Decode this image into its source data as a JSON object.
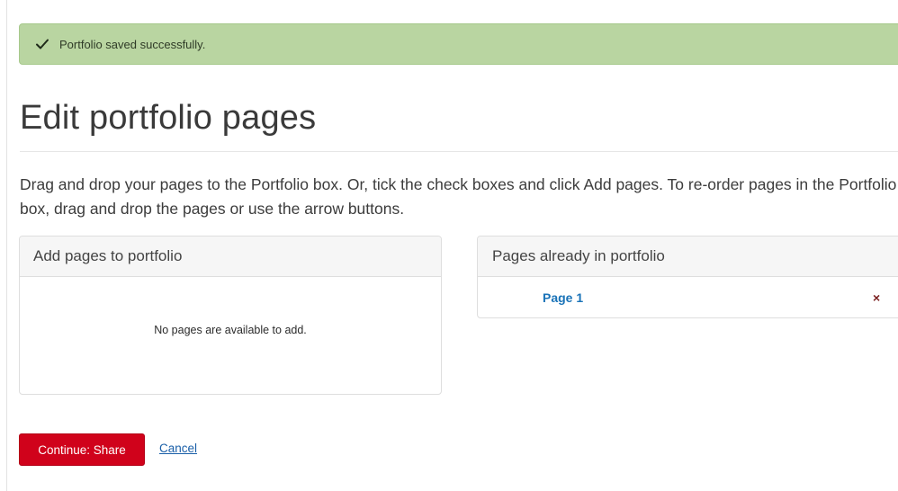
{
  "alert": {
    "icon": "check-icon",
    "message": "Portfolio saved successfully.",
    "color": "#b9d5a1"
  },
  "heading": "Edit portfolio pages",
  "intro": "Drag and drop your pages to the Portfolio box. Or, tick the check boxes and click Add pages. To re-order pages in the Portfolio box, drag and drop the pages or use the arrow buttons.",
  "add_panel": {
    "title": "Add pages to portfolio",
    "empty_message": "No pages are available to add."
  },
  "portfolio_panel": {
    "title": "Pages already in portfolio",
    "pages": [
      {
        "label": "Page 1",
        "remove_icon": "close-icon",
        "remove_label": "×"
      }
    ]
  },
  "actions": {
    "continue_label": "Continue: Share",
    "continue_color": "#d0021b",
    "cancel_label": "Cancel"
  }
}
